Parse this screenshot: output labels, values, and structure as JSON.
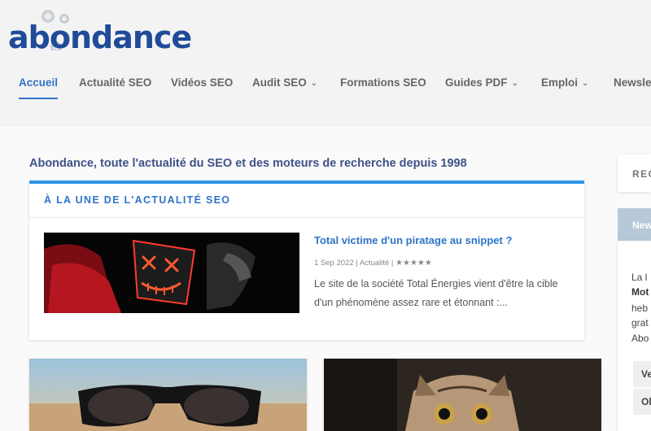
{
  "brand": {
    "logo_text": "abondance"
  },
  "nav": {
    "items": [
      {
        "label": "Accueil",
        "active": true,
        "dropdown": false
      },
      {
        "label": "Actualité SEO",
        "active": false,
        "dropdown": false
      },
      {
        "label": "Vidéos SEO",
        "active": false,
        "dropdown": false
      },
      {
        "label": "Audit SEO",
        "active": false,
        "dropdown": true
      },
      {
        "label": "Formations SEO",
        "active": false,
        "dropdown": false
      },
      {
        "label": "Guides PDF",
        "active": false,
        "dropdown": true
      },
      {
        "label": "Emploi",
        "active": false,
        "dropdown": true
      },
      {
        "label": "Newsle",
        "active": false,
        "dropdown": false
      }
    ],
    "chevron_glyph": "⌄"
  },
  "main": {
    "tagline": "Abondance, toute l'actualité du SEO et des moteurs de recherche depuis 1998",
    "featured": {
      "section_title": "À LA UNE DE L'ACTUALITÉ SEO",
      "article": {
        "title": "Total victime d'un piratage au snippet ?",
        "date": "1 Sep 2022",
        "category": "Actualité",
        "separator": "|",
        "rating_stars": "★★★★★",
        "excerpt": "Le site de la société Total Énergies vient d'être la cible d'un phénomène assez rare et étonnant :..."
      }
    }
  },
  "sidebar": {
    "box1_label": "REC",
    "box2_label": "New",
    "box3_lines": [
      "La l",
      "Mot",
      "heb",
      "grat",
      "Abo"
    ],
    "buttons": [
      "Ve",
      "Ol"
    ]
  },
  "colors": {
    "accent": "#2e73c8",
    "logo": "#1f4b99",
    "tagline": "#3f5189",
    "card_bar": "#2e97e8",
    "sidebar_header": "#b7c9d9"
  },
  "icons": {
    "logo": "gears-logo-icon",
    "chevron": "chevron-down-icon",
    "rating": "star-icon"
  }
}
